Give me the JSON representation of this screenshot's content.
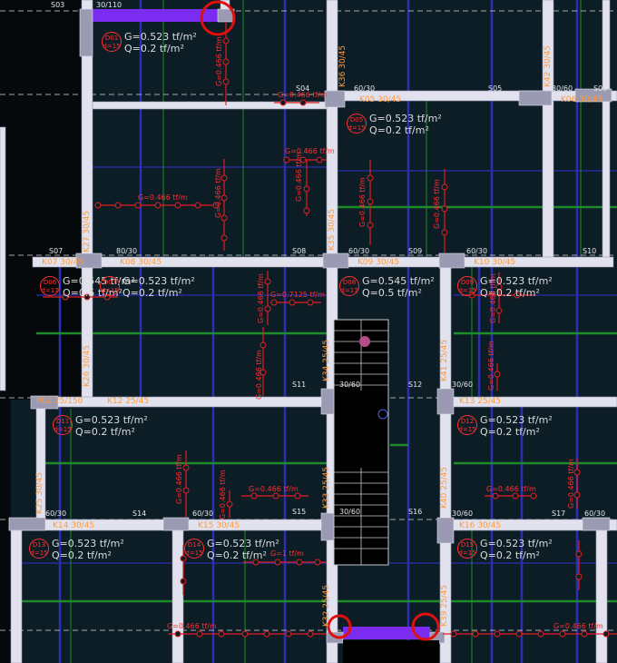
{
  "beams": [
    {
      "id": "b1",
      "label": "K05 30/45"
    },
    {
      "id": "b2",
      "label": "K06 30/45"
    },
    {
      "id": "b3",
      "label": "K07 30/45"
    },
    {
      "id": "b4",
      "label": "K08 30/45"
    },
    {
      "id": "b5",
      "label": "K09 30/45"
    },
    {
      "id": "b6",
      "label": "K10 30/45"
    },
    {
      "id": "b7",
      "label": "P02 25/150"
    },
    {
      "id": "b8",
      "label": "K12 25/45"
    },
    {
      "id": "b9",
      "label": "K13 25/45"
    },
    {
      "id": "b10",
      "label": "K14 30/45"
    },
    {
      "id": "b11",
      "label": "K15 30/45"
    },
    {
      "id": "b12",
      "label": "K16 30/45"
    },
    {
      "id": "b13",
      "label": "K36 30/45"
    },
    {
      "id": "b14",
      "label": "K27 30/45"
    },
    {
      "id": "b15",
      "label": "K35 30/45"
    },
    {
      "id": "b16",
      "label": "K26 30/45"
    },
    {
      "id": "b17",
      "label": "K34 25/45"
    },
    {
      "id": "b18",
      "label": "K41 25/45"
    },
    {
      "id": "b19",
      "label": "K25 30/45"
    },
    {
      "id": "b20",
      "label": "K33 25/45"
    },
    {
      "id": "b21",
      "label": "K40 25/45"
    },
    {
      "id": "b22",
      "label": "K32 25/45"
    },
    {
      "id": "b23",
      "label": "K39 25/45"
    },
    {
      "id": "b24",
      "label": "K42 30/45"
    }
  ],
  "columns": [
    {
      "id": "c1",
      "label": "30/110"
    },
    {
      "id": "c2",
      "label": "60/30"
    },
    {
      "id": "c3",
      "label": "80/30"
    },
    {
      "id": "c4",
      "label": "60/30"
    },
    {
      "id": "c5",
      "label": "60/30"
    },
    {
      "id": "c6",
      "label": "30/60"
    },
    {
      "id": "c7",
      "label": "30/60"
    },
    {
      "id": "c8",
      "label": "30/60"
    },
    {
      "id": "c9",
      "label": "60/30"
    },
    {
      "id": "c10",
      "label": "30/60"
    },
    {
      "id": "c11",
      "label": "60/30"
    },
    {
      "id": "c12",
      "label": "30/60"
    },
    {
      "id": "c13",
      "label": "60/30"
    }
  ],
  "slabs_text": [
    {
      "id": "s1",
      "label": "S03"
    },
    {
      "id": "s2",
      "label": "S04"
    },
    {
      "id": "s3",
      "label": "S05"
    },
    {
      "id": "s4",
      "label": "S06"
    },
    {
      "id": "s5",
      "label": "S07"
    },
    {
      "id": "s6",
      "label": "S08"
    },
    {
      "id": "s7",
      "label": "S09"
    },
    {
      "id": "s8",
      "label": "S10"
    },
    {
      "id": "s9",
      "label": "S11"
    },
    {
      "id": "s10",
      "label": "S12"
    },
    {
      "id": "s11",
      "label": "S14"
    },
    {
      "id": "s12",
      "label": "S15"
    },
    {
      "id": "s13",
      "label": "S16"
    },
    {
      "id": "s14",
      "label": "S17"
    }
  ],
  "slab_loads": [
    {
      "id": "D01",
      "thk": "d=15",
      "g": "G=0.523 tf/m²",
      "q": "Q=0.2 tf/m²"
    },
    {
      "id": "D05",
      "thk": "d=15",
      "g": "G=0.523 tf/m²",
      "q": "Q=0.2 tf/m²"
    },
    {
      "id": "D06",
      "thk": "d=17",
      "g": "G=0.545 tf/m²",
      "q": "Q=0.5 tf/m²"
    },
    {
      "id": "D07",
      "thk": "d=15",
      "g": "G=0.523 tf/m²",
      "q": "Q=0.2 tf/m²"
    },
    {
      "id": "D08",
      "thk": "d=17",
      "g": "G=0.545 tf/m²",
      "q": "Q=0.5 tf/m²"
    },
    {
      "id": "D09",
      "thk": "d=15",
      "g": "G=0.523 tf/m²",
      "q": "Q=0.2 tf/m²"
    },
    {
      "id": "D11",
      "thk": "d=15",
      "g": "G=0.523 tf/m²",
      "q": "Q=0.2 tf/m²"
    },
    {
      "id": "D12",
      "thk": "d=15",
      "g": "G=0.523 tf/m²",
      "q": "Q=0.2 tf/m²"
    },
    {
      "id": "D13",
      "thk": "d=15",
      "g": "G=0.523 tf/m²",
      "q": "Q=0.2 tf/m²"
    },
    {
      "id": "D14",
      "thk": "d=15",
      "g": "G=0.523 tf/m²",
      "q": "Q=0.2 tf/m²"
    },
    {
      "id": "D15",
      "thk": "d=15",
      "g": "G=0.523 tf/m²",
      "q": "Q=0.2 tf/m²"
    }
  ],
  "line_loads": [
    {
      "id": "l1",
      "label": "G=0.466 tf/m"
    },
    {
      "id": "l2",
      "label": "G=0.466 tf/m"
    },
    {
      "id": "l3",
      "label": "G=0.466 tf/m"
    },
    {
      "id": "l4",
      "label": "G=0.466 tf/m"
    },
    {
      "id": "l5",
      "label": "G=0.466 tf/m"
    },
    {
      "id": "l6",
      "label": "G=0.466 tf/m"
    },
    {
      "id": "l7",
      "label": "G=0.7125 tf/m"
    },
    {
      "id": "l8",
      "label": "G=0.466 tf/m"
    },
    {
      "id": "l9",
      "label": "G=0.466 tf/m"
    },
    {
      "id": "l10",
      "label": "G=0.466 tf/m"
    },
    {
      "id": "l11",
      "label": "G=0.466 tf/m"
    },
    {
      "id": "l12",
      "label": "G=0.466 tf/m"
    },
    {
      "id": "l13",
      "label": "G=0.466 tf/m"
    },
    {
      "id": "l14",
      "label": "G=0.466 tf/m"
    },
    {
      "id": "l15",
      "label": "G=1 tf/m"
    },
    {
      "id": "l16",
      "label": "G=0.466 tf/m"
    },
    {
      "id": "l17",
      "label": "G=0.466 tf/m"
    },
    {
      "id": "l18",
      "label": "G=0.466 tf/m"
    },
    {
      "id": "l19",
      "label": "G=0.466 tf/m"
    },
    {
      "id": "l20",
      "label": "G=0.466 tf/m"
    },
    {
      "id": "l21",
      "label": "G=0.466 tf/m"
    }
  ],
  "colors": {
    "background": "#0c1d26",
    "beam": "#e2e2ee",
    "column": "#9a9ab2",
    "highlight_beam": "#7a2df0",
    "circle_marker": "#e01010",
    "gridline_blue": "#2b2fb0",
    "gridline_green": "#1f8a2a",
    "load_line": "#e02020",
    "label_orange": "#ff9a3c"
  }
}
